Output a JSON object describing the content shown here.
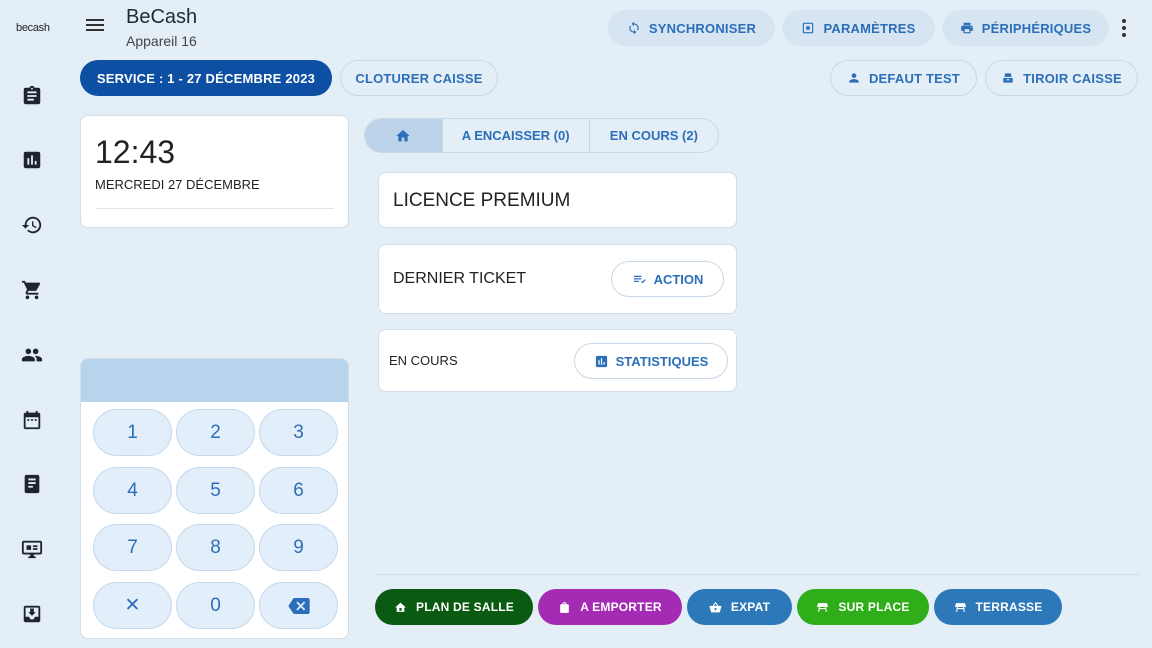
{
  "rail": {
    "logo": "becash",
    "icons": [
      "clipboard-icon",
      "bar-chart-icon",
      "history-icon",
      "cart-icon",
      "people-icon",
      "calendar-icon",
      "book-icon",
      "monitor-icon",
      "inbox-download-icon"
    ]
  },
  "header": {
    "title": "BeCash",
    "subtitle": "Appareil 16",
    "sync_label": "SYNCHRONISER",
    "settings_label": "PARAMÈTRES",
    "devices_label": "PÉRIPHÉRIQUES"
  },
  "service_bar": {
    "service_label": "SERVICE : 1 - 27 DÉCEMBRE 2023",
    "close_label": "CLOTURER CAISSE",
    "user_label": "DEFAUT TEST",
    "drawer_label": "TIROIR CAISSE"
  },
  "clock": {
    "time": "12:43",
    "date": "MERCREDI 27 DÉCEMBRE"
  },
  "keypad": {
    "keys": [
      "1",
      "2",
      "3",
      "4",
      "5",
      "6",
      "7",
      "8",
      "9",
      "✕",
      "0"
    ]
  },
  "tabs": {
    "to_collect": "A ENCAISSER (0)",
    "in_progress": "EN COURS (2)"
  },
  "cards": {
    "license": "LICENCE PREMIUM",
    "last_ticket": "DERNIER TICKET",
    "action_label": "ACTION",
    "in_progress": "EN COURS",
    "stats_label": "STATISTIQUES"
  },
  "modes": {
    "room_plan": "PLAN DE SALLE",
    "takeaway": "A EMPORTER",
    "expat": "EXPAT",
    "on_site": "SUR PLACE",
    "terrace": "TERRASSE"
  },
  "colors": {
    "primary": "#0d4fa3",
    "accent": "#2c6fb8",
    "room_plan": "#0a5a12",
    "takeaway": "#a42bb4",
    "expat": "#2d78b9",
    "on_site": "#2fae1a",
    "terrace": "#2d78b9"
  }
}
